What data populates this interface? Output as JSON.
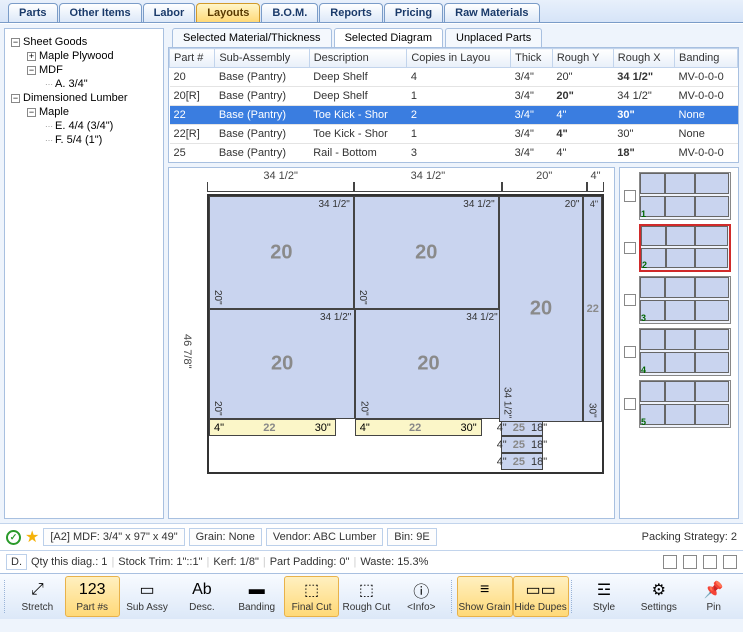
{
  "tabs": [
    "Parts",
    "Other Items",
    "Labor",
    "Layouts",
    "B.O.M.",
    "Reports",
    "Pricing",
    "Raw Materials"
  ],
  "active_tab": "Layouts",
  "sidebar": {
    "sheet_goods": "Sheet Goods",
    "maple_plywood": "Maple Plywood",
    "mdf": "MDF",
    "mdf_a": "A. 3/4\"",
    "dim_lumber": "Dimensioned Lumber",
    "maple": "Maple",
    "maple_e": "E. 4/4 (3/4\")",
    "maple_f": "F. 5/4 (1\")"
  },
  "subtabs": [
    "Selected Material/Thickness",
    "Selected Diagram",
    "Unplaced Parts"
  ],
  "active_subtab": "Selected Diagram",
  "grid": {
    "cols": [
      "Part #",
      "Sub-Assembly",
      "Description",
      "Copies in Layou",
      "Thick",
      "Rough Y",
      "Rough X",
      "Banding"
    ],
    "rows": [
      {
        "p": "20",
        "sa": "Base (Pantry)",
        "d": "Deep Shelf",
        "c": "4",
        "t": "3/4\"",
        "ry": "20\"",
        "rx": "34 1/2\"",
        "b": "MV-0-0-0",
        "bold": "rx"
      },
      {
        "p": "20[R]",
        "sa": "Base (Pantry)",
        "d": "Deep Shelf",
        "c": "1",
        "t": "3/4\"",
        "ry": "20\"",
        "rx": "34 1/2\"",
        "b": "MV-0-0-0",
        "bold": "ry"
      },
      {
        "p": "22",
        "sa": "Base (Pantry)",
        "d": "Toe Kick - Shor",
        "c": "2",
        "t": "3/4\"",
        "ry": "4\"",
        "rx": "30\"",
        "b": "None",
        "sel": true,
        "bold": "rx"
      },
      {
        "p": "22[R]",
        "sa": "Base (Pantry)",
        "d": "Toe Kick - Shor",
        "c": "1",
        "t": "3/4\"",
        "ry": "4\"",
        "rx": "30\"",
        "b": "None",
        "bold": "ry"
      },
      {
        "p": "25",
        "sa": "Base (Pantry)",
        "d": "Rail - Bottom",
        "c": "3",
        "t": "3/4\"",
        "ry": "4\"",
        "rx": "18\"",
        "b": "MV-0-0-0",
        "bold": "rx"
      }
    ]
  },
  "diagram": {
    "top_dims": [
      {
        "w": "34 1/2\"",
        "flex": 345
      },
      {
        "w": "34 1/2\"",
        "flex": 345
      },
      {
        "w": "20\"",
        "flex": 200
      },
      {
        "w": "4\"",
        "flex": 40
      }
    ],
    "left_dim": "46 7/8\"",
    "big": [
      {
        "pn": "20",
        "w": "34 1/2\"",
        "h": "20\""
      },
      {
        "pn": "20",
        "w": "34 1/2\"",
        "h": "20\""
      }
    ],
    "tall": {
      "pn": "20",
      "w": "20\"",
      "h": "34 1/2\""
    },
    "strip": {
      "pn": "22",
      "w": "4\"",
      "h": "30\""
    },
    "yellow": [
      {
        "pn": "22",
        "w": "30\"",
        "h": "4\""
      },
      {
        "pn": "22",
        "w": "30\"",
        "h": "4\""
      }
    ],
    "small": [
      {
        "pn": "25",
        "w": "18\"",
        "h": "4\""
      },
      {
        "pn": "25",
        "w": "18\"",
        "h": "4\""
      },
      {
        "pn": "25",
        "w": "18\"",
        "h": "4\""
      }
    ]
  },
  "thumbs": [
    1,
    2,
    3,
    4,
    5
  ],
  "selected_thumb": 2,
  "info": {
    "sheet": "[A2] MDF: 3/4\" x 97\" x 49\"",
    "grain": "Grain: None",
    "vendor": "Vendor: ABC Lumber",
    "bin": "Bin: 9E",
    "packing": "Packing Strategy: 2",
    "d": "D.",
    "qty": "Qty this diag.: 1",
    "stock": "Stock Trim: 1\"::1\"",
    "kerf": "Kerf: 1/8\"",
    "pad": "Part Padding: 0\"",
    "waste": "Waste: 15.3%"
  },
  "toolbar": [
    {
      "id": "stretch",
      "label": "Stretch",
      "icon": "⤢"
    },
    {
      "id": "partnums",
      "label": "Part #s",
      "icon": "123",
      "on": true
    },
    {
      "id": "subassy",
      "label": "Sub Assy",
      "icon": "▭"
    },
    {
      "id": "desc",
      "label": "Desc.",
      "icon": "Ab"
    },
    {
      "id": "banding",
      "label": "Banding",
      "icon": "▬"
    },
    {
      "id": "finalcut",
      "label": "Final Cut",
      "icon": "⬚",
      "on": true
    },
    {
      "id": "roughcut",
      "label": "Rough Cut",
      "icon": "⬚"
    },
    {
      "id": "info",
      "label": "<Info>",
      "icon": "ⓘ"
    },
    {
      "id": "showgrain",
      "label": "Show Grain",
      "icon": "≡",
      "on": true
    },
    {
      "id": "hidedupes",
      "label": "Hide Dupes",
      "icon": "▭▭",
      "on": true
    },
    {
      "id": "style",
      "label": "Style",
      "icon": "☲"
    },
    {
      "id": "settings",
      "label": "Settings",
      "icon": "⚙"
    },
    {
      "id": "pin",
      "label": "Pin",
      "icon": "📌"
    }
  ]
}
